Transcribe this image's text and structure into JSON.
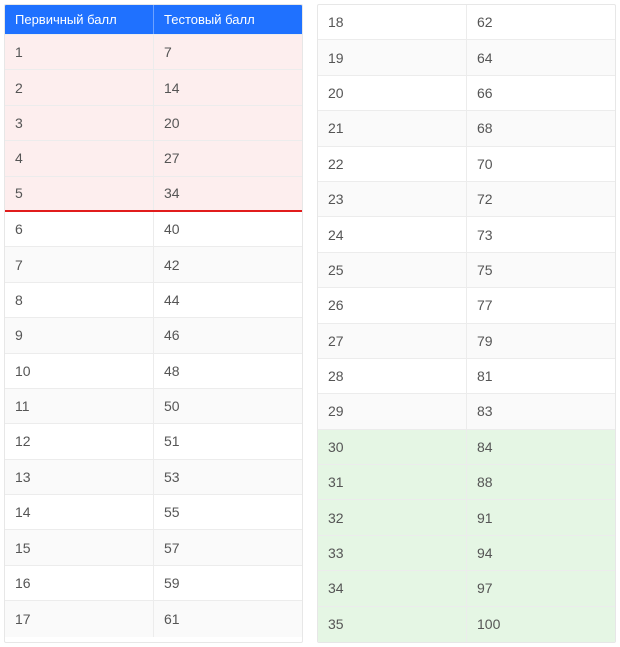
{
  "header": {
    "col1": "Первичный балл",
    "col2": "Тестовый балл"
  },
  "left": [
    {
      "a": "1",
      "b": "7",
      "style": "pink"
    },
    {
      "a": "2",
      "b": "14",
      "style": "pink"
    },
    {
      "a": "3",
      "b": "20",
      "style": "pink"
    },
    {
      "a": "4",
      "b": "27",
      "style": "pink"
    },
    {
      "a": "5",
      "b": "34",
      "style": "pink",
      "threshold": true
    },
    {
      "a": "6",
      "b": "40",
      "style": ""
    },
    {
      "a": "7",
      "b": "42",
      "style": "white-alt"
    },
    {
      "a": "8",
      "b": "44",
      "style": ""
    },
    {
      "a": "9",
      "b": "46",
      "style": "white-alt"
    },
    {
      "a": "10",
      "b": "48",
      "style": ""
    },
    {
      "a": "11",
      "b": "50",
      "style": "white-alt"
    },
    {
      "a": "12",
      "b": "51",
      "style": ""
    },
    {
      "a": "13",
      "b": "53",
      "style": "white-alt"
    },
    {
      "a": "14",
      "b": "55",
      "style": ""
    },
    {
      "a": "15",
      "b": "57",
      "style": "white-alt"
    },
    {
      "a": "16",
      "b": "59",
      "style": ""
    },
    {
      "a": "17",
      "b": "61",
      "style": "white-alt"
    }
  ],
  "right": [
    {
      "a": "18",
      "b": "62",
      "style": ""
    },
    {
      "a": "19",
      "b": "64",
      "style": "white-alt"
    },
    {
      "a": "20",
      "b": "66",
      "style": ""
    },
    {
      "a": "21",
      "b": "68",
      "style": "white-alt"
    },
    {
      "a": "22",
      "b": "70",
      "style": ""
    },
    {
      "a": "23",
      "b": "72",
      "style": "white-alt"
    },
    {
      "a": "24",
      "b": "73",
      "style": ""
    },
    {
      "a": "25",
      "b": "75",
      "style": "white-alt"
    },
    {
      "a": "26",
      "b": "77",
      "style": ""
    },
    {
      "a": "27",
      "b": "79",
      "style": "white-alt"
    },
    {
      "a": "28",
      "b": "81",
      "style": ""
    },
    {
      "a": "29",
      "b": "83",
      "style": "white-alt"
    },
    {
      "a": "30",
      "b": "84",
      "style": "green"
    },
    {
      "a": "31",
      "b": "88",
      "style": "green"
    },
    {
      "a": "32",
      "b": "91",
      "style": "green"
    },
    {
      "a": "33",
      "b": "94",
      "style": "green"
    },
    {
      "a": "34",
      "b": "97",
      "style": "green"
    },
    {
      "a": "35",
      "b": "100",
      "style": "green"
    }
  ]
}
